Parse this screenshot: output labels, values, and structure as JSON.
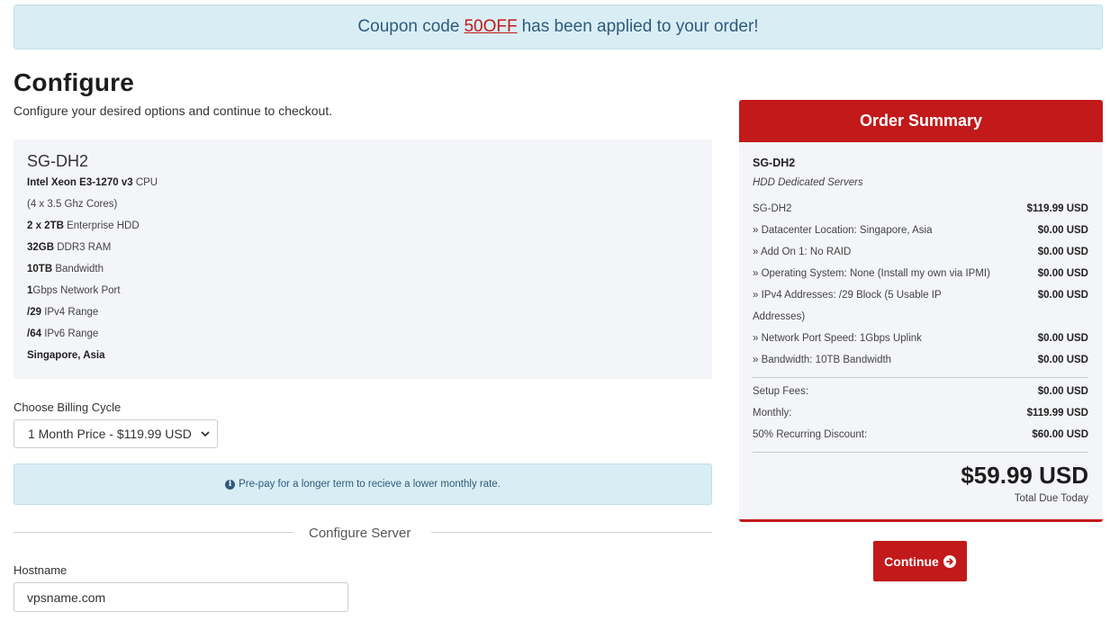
{
  "banner": {
    "prefix": "Coupon code",
    "code": "50OFF",
    "suffix": "has been applied to your order!"
  },
  "page": {
    "title": "Configure",
    "subtitle": "Configure your desired options and continue to checkout."
  },
  "product": {
    "name": "SG-DH2",
    "specs": [
      {
        "bold": "Intel Xeon E3-1270 v3",
        "text": " CPU"
      },
      {
        "bold": "",
        "text": "(4 x 3.5 Ghz Cores)"
      },
      {
        "bold": "2 x 2TB",
        "text": " Enterprise HDD"
      },
      {
        "bold": "32GB",
        "text": " DDR3 RAM"
      },
      {
        "bold": "10TB",
        "text": " Bandwidth"
      },
      {
        "bold": "1",
        "text": "Gbps Network Port"
      },
      {
        "bold": "/29",
        "text": " IPv4 Range"
      },
      {
        "bold": "/64",
        "text": " IPv6 Range"
      },
      {
        "bold": "Singapore, Asia",
        "text": ""
      }
    ]
  },
  "billing": {
    "label": "Choose Billing Cycle",
    "selected": "1 Month Price - $119.99 USD"
  },
  "info": {
    "text": "Pre-pay for a longer term to recieve a lower monthly rate."
  },
  "configure": {
    "section_title": "Configure Server",
    "hostname_label": "Hostname",
    "hostname_value": "vpsname.com"
  },
  "summary": {
    "title": "Order Summary",
    "product": "SG-DH2",
    "group": "HDD Dedicated Servers",
    "lines": [
      {
        "label": "SG-DH2",
        "price": "$119.99 USD"
      },
      {
        "label": " » Datacenter Location: Singapore, Asia",
        "price": "$0.00 USD"
      },
      {
        "label": " » Add On 1: No RAID",
        "price": "$0.00 USD"
      },
      {
        "label": " » Operating System: None (Install my own via IPMI)",
        "price": "$0.00 USD"
      },
      {
        "label": " » IPv4 Addresses: /29 Block (5 Usable IP",
        "label2": "Addresses)",
        "price": "$0.00 USD"
      },
      {
        "label": " » Network Port Speed: 1Gbps Uplink",
        "price": "$0.00 USD"
      },
      {
        "label": " » Bandwidth: 10TB Bandwidth",
        "price": "$0.00 USD"
      }
    ],
    "fees": [
      {
        "label": "Setup Fees:",
        "price": "$0.00 USD"
      },
      {
        "label": "Monthly:",
        "price": "$119.99 USD"
      },
      {
        "label": "50% Recurring Discount:",
        "price": "$60.00 USD"
      }
    ],
    "total": "$59.99 USD",
    "total_label": "Total Due Today"
  },
  "continue_label": "Continue",
  "colors": {
    "brand_red": "#c2191a",
    "info_bg": "#d9edf4",
    "panel_bg": "#f4f5f8"
  }
}
